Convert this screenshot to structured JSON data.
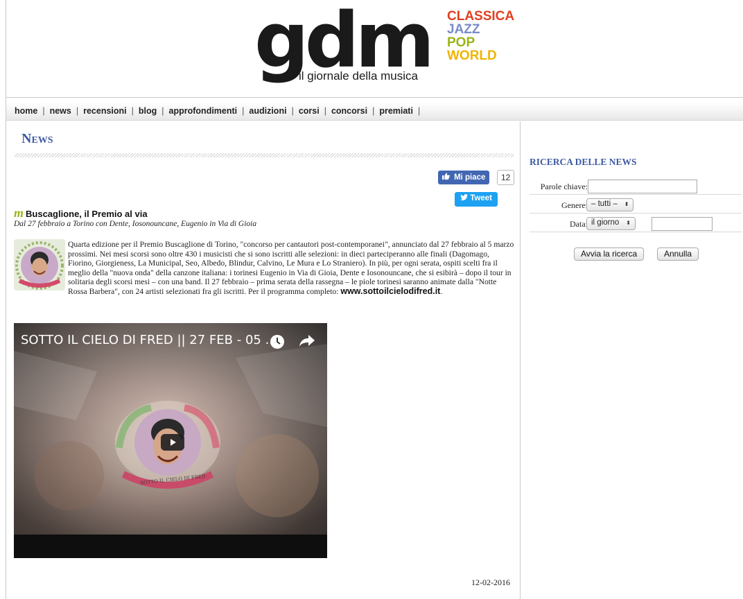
{
  "logo": {
    "brand": "gdm",
    "tagline": "il giornale della musica",
    "genres": [
      {
        "label": "CLASSICA",
        "color": "#e0401f"
      },
      {
        "label": "JAZZ",
        "color": "#7a8cc8"
      },
      {
        "label": "POP",
        "color": "#9cb318"
      },
      {
        "label": "WORLD",
        "color": "#f0b400"
      }
    ]
  },
  "nav": {
    "items": [
      "home",
      "news",
      "recensioni",
      "blog",
      "approfondimenti",
      "audizioni",
      "corsi",
      "concorsi",
      "premiati"
    ],
    "separator": "|"
  },
  "main": {
    "section_title": "News",
    "social": {
      "like_label": "Mi piace",
      "like_count": "12",
      "tweet_label": "Tweet",
      "like_icon": "thumbs-up-icon",
      "tweet_icon": "twitter-bird-icon"
    },
    "article": {
      "category_icon": "m",
      "title": "Buscaglione, il Premio al via",
      "subtitle": "Dal 27 febbraio a Torino con Dente, Iosonouncane, Eugenio in Via di Gioia",
      "body": "Quarta edizione per il Premio Buscaglione di Torino, \"concorso per cantautori post-contemporanei\", annunciato dal 27 febbraio al 5 marzo prossimi. Nei mesi scorsi sono oltre 430 i musicisti che si sono iscritti alle selezioni: in dieci parteciperanno alle finali (Dagomago, Fiorino, Giorgieness, La Municipal, Seo, Albedo, Blindur, Calvino, Le Mura e Lo Straniero). In più, per ogni serata, ospiti scelti fra il meglio della \"nuova onda\" della canzone italiana: i torinesi Eugenio in Via di Gioia, Dente e Iosonouncane, che si esibirà – dopo il tour in solitaria degli scorsi mesi – con una band. Il 27 febbraio – prima serata della rassegna – le piole torinesi saranno animate dalla \"Notte Rossa Barbera\", con 24 artisti selezionati fra gli iscritti. Per il programma completo: ",
      "link_text": "www.sottoilcielodifred.it",
      "body_end": ".",
      "video_title": "SOTTO IL CIELO DI FRED || 27 FEB - 05 ...",
      "poster_caption": "SOTTO IL CIELO DI FRED",
      "date": "12-02-2016"
    }
  },
  "sidebar": {
    "title": "RICERCA DELLE NEWS",
    "keywords_label": "Parole chiave:",
    "keywords_value": "",
    "genre_label": "Genere:",
    "genre_selected": "– tutti –",
    "date_label": "Data:",
    "date_selected": "il giorno",
    "date_value": "",
    "search_button": "Avvia la ricerca",
    "cancel_button": "Annulla"
  }
}
